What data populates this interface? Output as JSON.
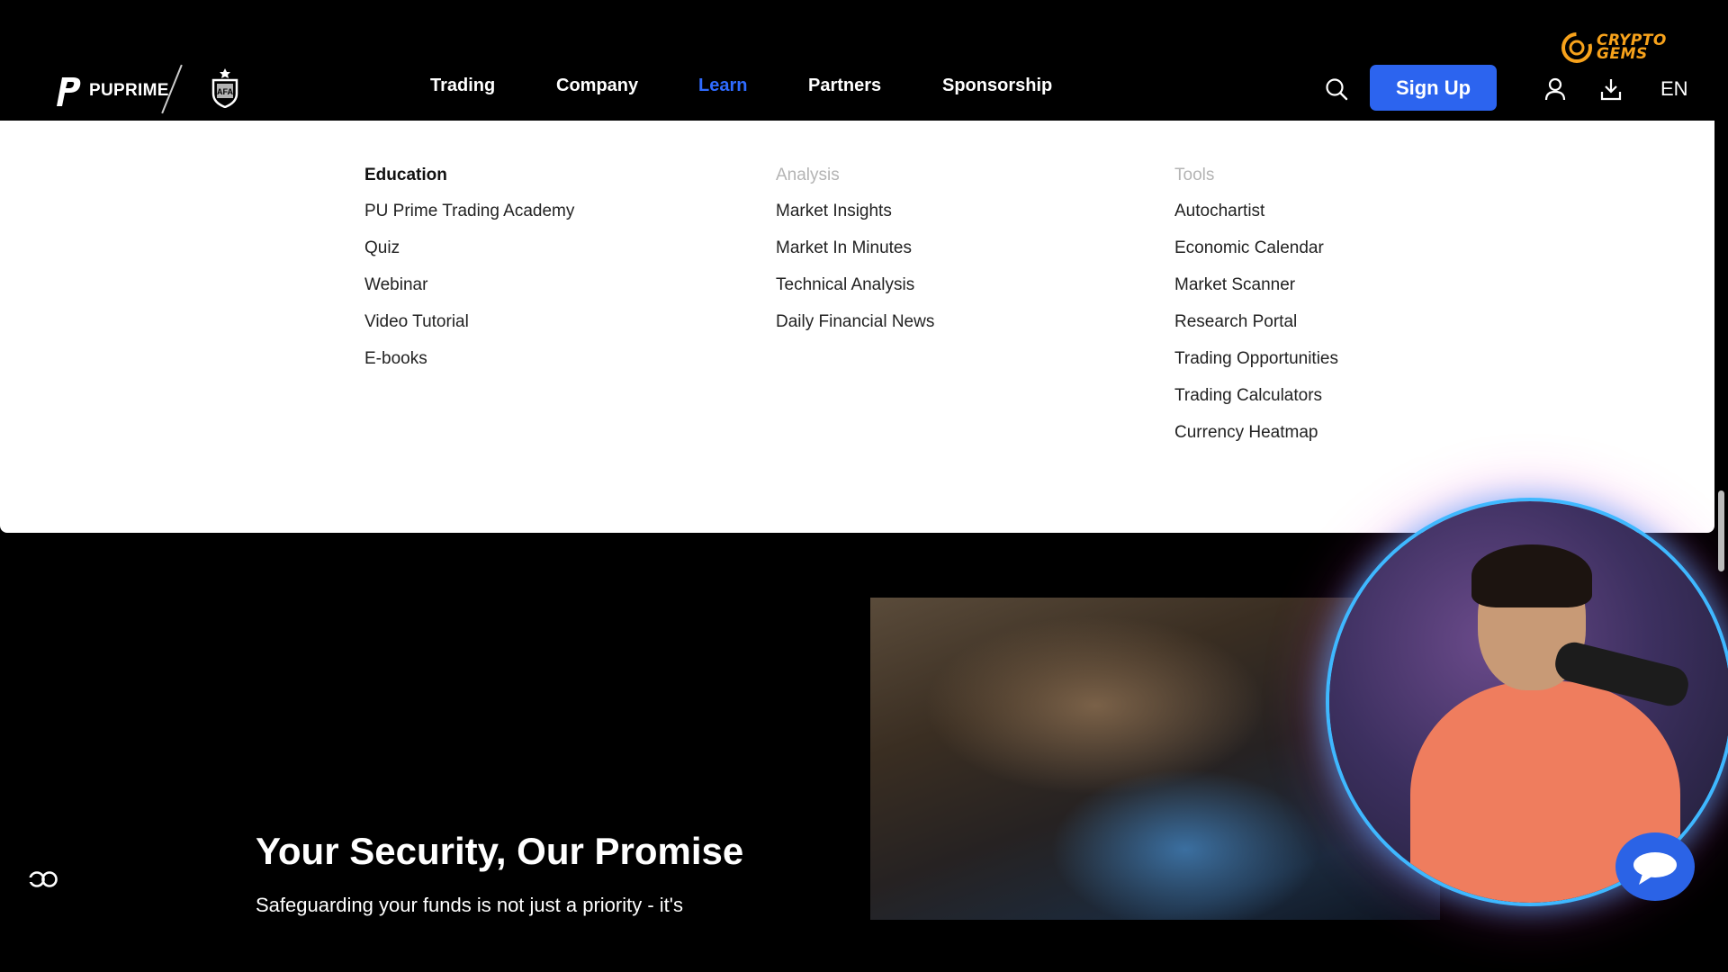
{
  "brand": {
    "logo_text": "PUPRIME",
    "partner_crest_icon": "afa-crest-icon"
  },
  "nav": {
    "items": [
      {
        "label": "Trading"
      },
      {
        "label": "Company"
      },
      {
        "label": "Learn",
        "active": true
      },
      {
        "label": "Partners"
      },
      {
        "label": "Sponsorship"
      }
    ]
  },
  "header_actions": {
    "search_icon": "search-icon",
    "signup_label": "Sign Up",
    "user_icon": "user-icon",
    "download_icon": "download-icon",
    "language": "EN"
  },
  "watermark": {
    "line1": "CRYPTO",
    "line2": "GEMS"
  },
  "dropdown": {
    "columns": [
      {
        "heading": "Education",
        "items": [
          "PU Prime Trading Academy",
          "Quiz",
          "Webinar",
          "Video Tutorial",
          "E-books"
        ]
      },
      {
        "heading": "Analysis",
        "items": [
          "Market Insights",
          "Market In Minutes",
          "Technical Analysis",
          "Daily Financial News"
        ]
      },
      {
        "heading": "Tools",
        "items": [
          "Autochartist",
          "Economic Calendar",
          "Market Scanner",
          "Research Portal",
          "Trading Opportunities",
          "Trading Calculators",
          "Currency Heatmap"
        ]
      }
    ]
  },
  "hero": {
    "title": "Your Security, Our Promise",
    "subtitle": "Safeguarding your funds is not just a priority - it's"
  },
  "colors": {
    "accent": "#2c64ef",
    "active_nav": "#2f6bff",
    "watermark": "#f7a21b"
  }
}
